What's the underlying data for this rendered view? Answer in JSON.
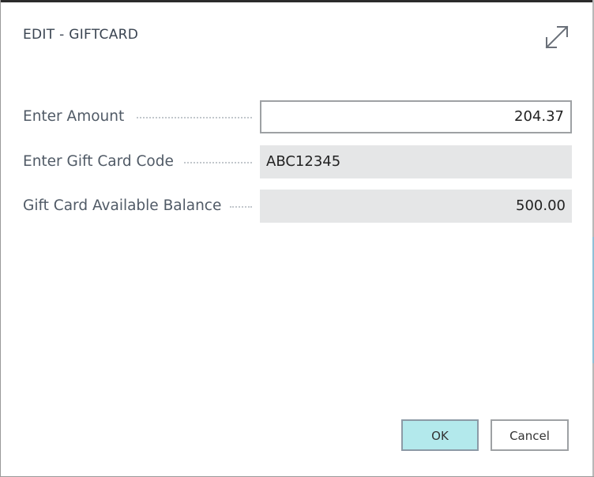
{
  "dialog": {
    "title": "EDIT - GIFTCARD",
    "expand_icon": "expand-arrows-icon"
  },
  "fields": [
    {
      "label": "Enter Amount",
      "value": "204.37",
      "editable": true
    },
    {
      "label": "Enter Gift Card Code",
      "value": "ABC12345",
      "editable": false
    },
    {
      "label": "Gift Card Available Balance",
      "value": "500.00",
      "editable": false
    }
  ],
  "buttons": {
    "ok_label": "OK",
    "cancel_label": "Cancel"
  },
  "colors": {
    "ok_button_bg": "#b3e9ec",
    "readonly_field_bg": "#e5e6e7",
    "label_text": "#505a66"
  }
}
